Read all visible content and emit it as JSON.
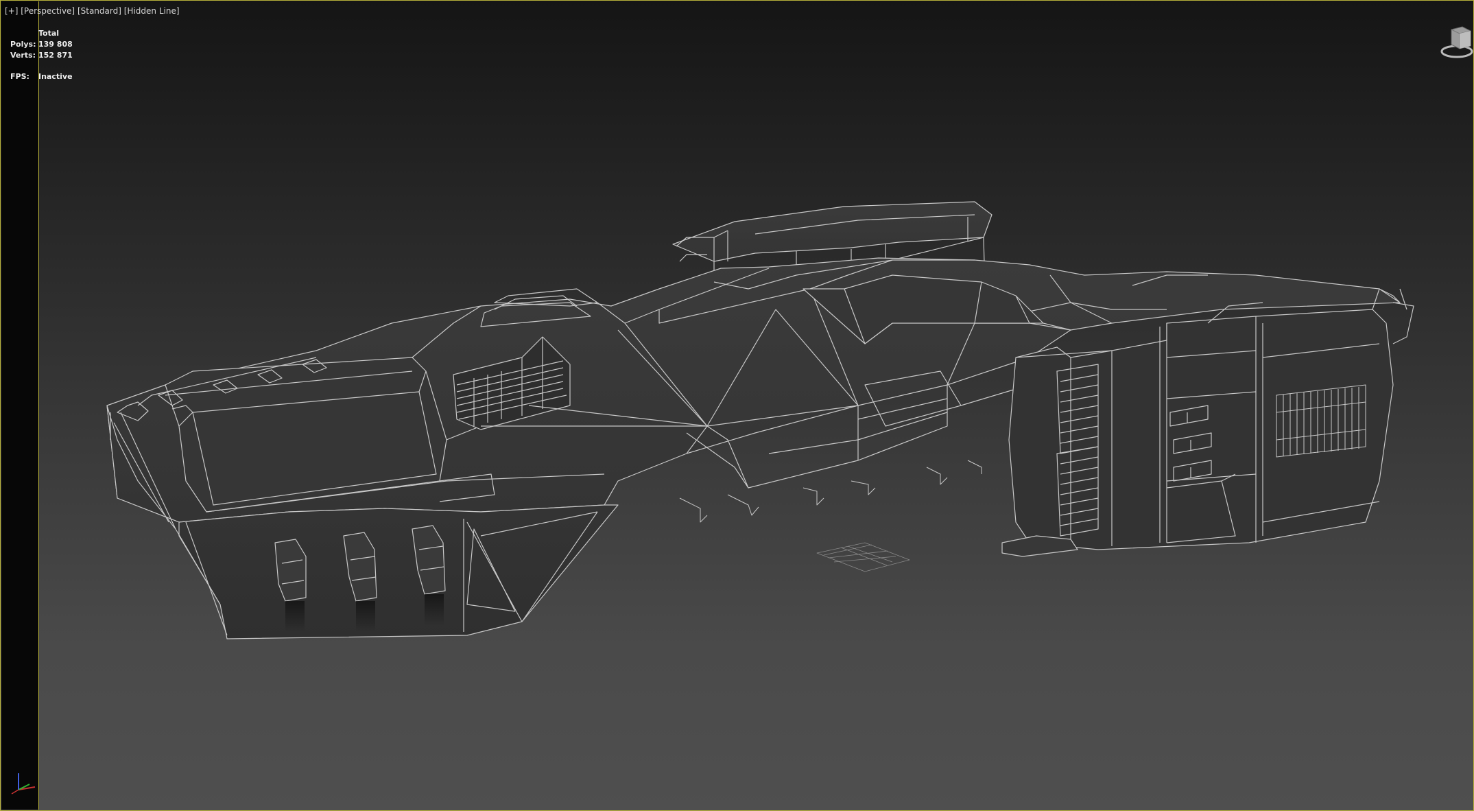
{
  "viewport": {
    "labels": {
      "plus": "[+]",
      "view": "[Perspective]",
      "shading": "[Standard]",
      "style": "[Hidden Line]"
    },
    "stats": {
      "header": "Total",
      "polys_label": "Polys:",
      "polys_value": "139 808",
      "verts_label": "Verts:",
      "verts_value": "152 871",
      "fps_label": "FPS:",
      "fps_value": "Inactive"
    }
  },
  "colors": {
    "active_border": "#b8b23a",
    "wire": "#c8c8c8",
    "x_axis": "#c83232",
    "y_axis": "#32b432",
    "z_axis": "#4060e0"
  },
  "icons": {
    "viewcube": "viewcube-icon",
    "axis": "axis-tripod-icon"
  }
}
